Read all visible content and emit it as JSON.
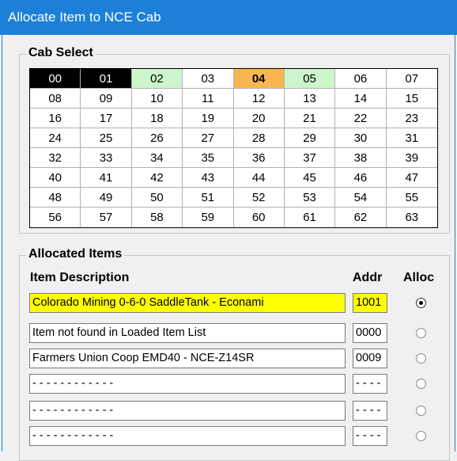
{
  "window": {
    "title": "Allocate Item to NCE Cab"
  },
  "cab_select": {
    "legend": "Cab Select",
    "selected": "04",
    "cabs": [
      {
        "label": "00",
        "state": "black"
      },
      {
        "label": "01",
        "state": "black"
      },
      {
        "label": "02",
        "state": "green"
      },
      {
        "label": "03",
        "state": "normal"
      },
      {
        "label": "04",
        "state": "orange"
      },
      {
        "label": "05",
        "state": "green"
      },
      {
        "label": "06",
        "state": "normal"
      },
      {
        "label": "07",
        "state": "normal"
      },
      {
        "label": "08",
        "state": "normal"
      },
      {
        "label": "09",
        "state": "normal"
      },
      {
        "label": "10",
        "state": "normal"
      },
      {
        "label": "11",
        "state": "normal"
      },
      {
        "label": "12",
        "state": "normal"
      },
      {
        "label": "13",
        "state": "normal"
      },
      {
        "label": "14",
        "state": "normal"
      },
      {
        "label": "15",
        "state": "normal"
      },
      {
        "label": "16",
        "state": "normal"
      },
      {
        "label": "17",
        "state": "normal"
      },
      {
        "label": "18",
        "state": "normal"
      },
      {
        "label": "19",
        "state": "normal"
      },
      {
        "label": "20",
        "state": "normal"
      },
      {
        "label": "21",
        "state": "normal"
      },
      {
        "label": "22",
        "state": "normal"
      },
      {
        "label": "23",
        "state": "normal"
      },
      {
        "label": "24",
        "state": "normal"
      },
      {
        "label": "25",
        "state": "normal"
      },
      {
        "label": "26",
        "state": "normal"
      },
      {
        "label": "27",
        "state": "normal"
      },
      {
        "label": "28",
        "state": "normal"
      },
      {
        "label": "29",
        "state": "normal"
      },
      {
        "label": "30",
        "state": "normal"
      },
      {
        "label": "31",
        "state": "normal"
      },
      {
        "label": "32",
        "state": "normal"
      },
      {
        "label": "33",
        "state": "normal"
      },
      {
        "label": "34",
        "state": "normal"
      },
      {
        "label": "35",
        "state": "normal"
      },
      {
        "label": "36",
        "state": "normal"
      },
      {
        "label": "37",
        "state": "normal"
      },
      {
        "label": "38",
        "state": "normal"
      },
      {
        "label": "39",
        "state": "normal"
      },
      {
        "label": "40",
        "state": "normal"
      },
      {
        "label": "41",
        "state": "normal"
      },
      {
        "label": "42",
        "state": "normal"
      },
      {
        "label": "43",
        "state": "normal"
      },
      {
        "label": "44",
        "state": "normal"
      },
      {
        "label": "45",
        "state": "normal"
      },
      {
        "label": "46",
        "state": "normal"
      },
      {
        "label": "47",
        "state": "normal"
      },
      {
        "label": "48",
        "state": "normal"
      },
      {
        "label": "49",
        "state": "normal"
      },
      {
        "label": "50",
        "state": "normal"
      },
      {
        "label": "51",
        "state": "normal"
      },
      {
        "label": "52",
        "state": "normal"
      },
      {
        "label": "53",
        "state": "normal"
      },
      {
        "label": "54",
        "state": "normal"
      },
      {
        "label": "55",
        "state": "normal"
      },
      {
        "label": "56",
        "state": "normal"
      },
      {
        "label": "57",
        "state": "normal"
      },
      {
        "label": "58",
        "state": "normal"
      },
      {
        "label": "59",
        "state": "normal"
      },
      {
        "label": "60",
        "state": "normal"
      },
      {
        "label": "61",
        "state": "normal"
      },
      {
        "label": "62",
        "state": "normal"
      },
      {
        "label": "63",
        "state": "normal"
      }
    ]
  },
  "allocated": {
    "legend": "Allocated Items",
    "col_desc": "Item Description",
    "col_addr": "Addr",
    "col_alloc": "Alloc",
    "items": [
      {
        "description": "Colorado Mining 0-6-0 SaddleTank - Econami",
        "addr": "1001",
        "alloc": true,
        "highlight": true
      },
      {
        "description": "Item not found in Loaded Item List",
        "addr": "0000",
        "alloc": false,
        "highlight": false
      },
      {
        "description": "Farmers Union Coop EMD40 - NCE-Z14SR",
        "addr": "0009",
        "alloc": false,
        "highlight": false
      },
      {
        "description": "- - - - - - - - - - - -",
        "addr": "- - - -",
        "alloc": false,
        "highlight": false
      },
      {
        "description": "- - - - - - - - - - - -",
        "addr": "- - - -",
        "alloc": false,
        "highlight": false
      },
      {
        "description": "- - - - - - - - - - - -",
        "addr": "- - - -",
        "alloc": false,
        "highlight": false
      }
    ]
  },
  "colors": {
    "titlebar": "#1c7fd8",
    "cab_active": "#000000",
    "cab_available": "#cdf5cc",
    "cab_selected": "#f9b650",
    "highlight": "#ffff00"
  }
}
